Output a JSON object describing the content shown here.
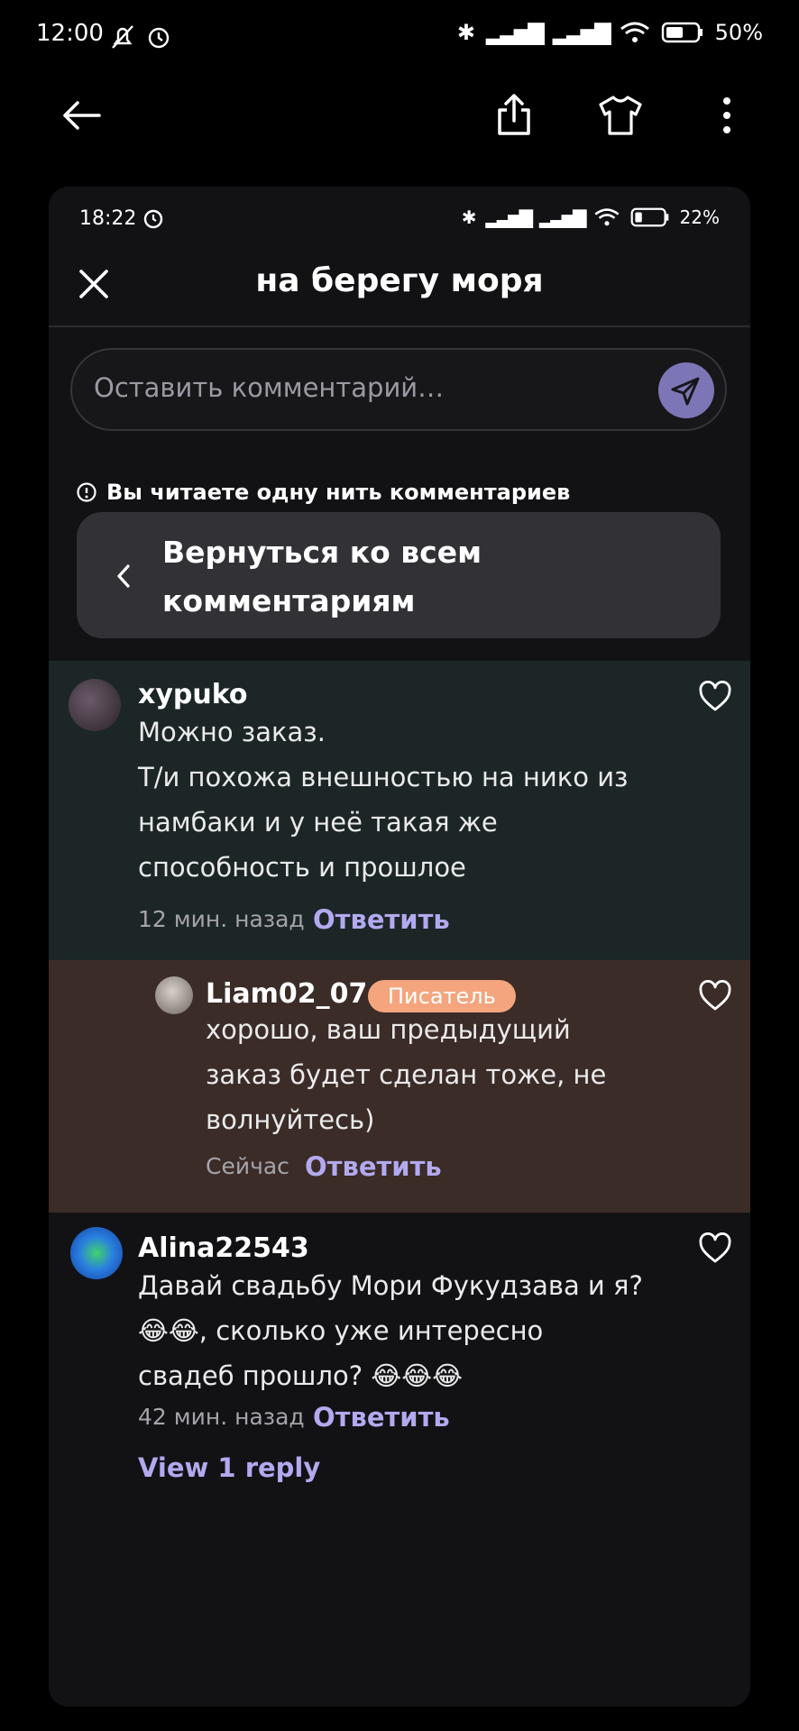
{
  "status_bar": {
    "time": "12:00",
    "battery": "50%"
  },
  "inner_status_bar": {
    "time": "18:22",
    "battery": "22%"
  },
  "sheet": {
    "title": "на берегу моря",
    "comment_placeholder": "Оставить комментарий…",
    "thread_note": "Вы читаете одну нить комментариев",
    "back_to_all": "Вернуться ко всем комментариям"
  },
  "comments": [
    {
      "username": "xypuko",
      "text": "Можно заказ.\nТ/и похожа внешностью на нико из\nнамбаки и  у неё такая же\nспособность и прошлое",
      "time": "12 мин. назад",
      "reply_label": "Ответить"
    },
    {
      "username": "Liam02_07",
      "badge": "Писатель",
      "text": "хорошо, ваш предыдущий\nзаказ будет сделан тоже, не\nволнуйтесь)",
      "time": "Сейчас",
      "reply_label": "Ответить"
    },
    {
      "username": "Alina22543",
      "text": "Давай свадьбу Мори Фукудзава и я?\n😂😂, сколько уже интересно\nсвадеб прошло? 😂😂😂",
      "time": "42 мин. назад",
      "reply_label": "Ответить",
      "view_replies": "View 1 reply"
    }
  ],
  "colors": {
    "accent": "#b2a9ef",
    "badge": "#f4a57e",
    "send": "#7d76b6"
  }
}
